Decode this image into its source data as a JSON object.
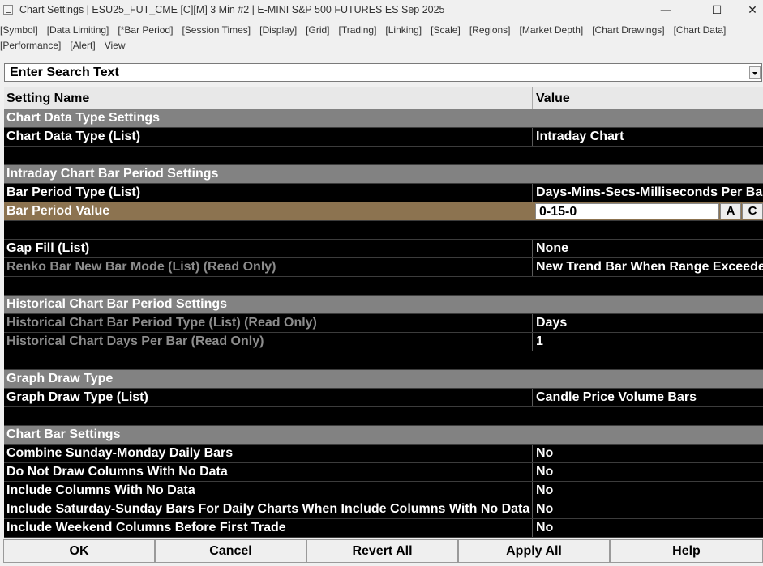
{
  "window": {
    "title": "Chart Settings | ESU25_FUT_CME [C][M]  3 Min  #2 | E-MINI S&P 500 FUTURES ES Sep 2025",
    "minimize": "—",
    "maximize": "☐",
    "close": "✕"
  },
  "menu": [
    "[Symbol]",
    "[Data Limiting]",
    "[*Bar Period]",
    "[Session Times]",
    "[Display]",
    "[Grid]",
    "[Trading]",
    "[Linking]",
    "[Scale]",
    "[Regions]",
    "[Market Depth]",
    "[Chart Drawings]",
    "[Chart Data]",
    "[Performance]",
    "[Alert]",
    "View"
  ],
  "search": {
    "text": "Enter Search Text"
  },
  "grid": {
    "header_name": "Setting Name",
    "header_value": "Value",
    "rows": [
      {
        "type": "section",
        "name": "Chart Data Type Settings"
      },
      {
        "type": "setting",
        "name": "Chart Data Type (List)",
        "value": "Intraday Chart"
      },
      {
        "type": "empty"
      },
      {
        "type": "section",
        "name": "Intraday Chart Bar Period Settings"
      },
      {
        "type": "setting",
        "name": "Bar Period Type (List)",
        "value": "Days-Mins-Secs-Milliseconds Per Bar"
      },
      {
        "type": "selected",
        "name": "Bar Period Value",
        "value": "0-15-0"
      },
      {
        "type": "empty"
      },
      {
        "type": "setting",
        "name": "Gap Fill (List)",
        "value": "None"
      },
      {
        "type": "readonly",
        "name": "Renko Bar New Bar Mode (List) (Read Only)",
        "value": "New Trend Bar When Range Exceeded"
      },
      {
        "type": "empty"
      },
      {
        "type": "section",
        "name": "Historical Chart Bar Period Settings"
      },
      {
        "type": "readonly",
        "name": "Historical Chart Bar Period Type (List) (Read Only)",
        "value": "Days"
      },
      {
        "type": "readonly",
        "name": "Historical Chart Days Per Bar (Read Only)",
        "value": "1"
      },
      {
        "type": "empty"
      },
      {
        "type": "section",
        "name": "Graph Draw Type"
      },
      {
        "type": "setting",
        "name": "Graph Draw Type (List)",
        "value": "Candle Price Volume Bars"
      },
      {
        "type": "empty"
      },
      {
        "type": "section",
        "name": "Chart Bar Settings"
      },
      {
        "type": "setting",
        "name": "Combine Sunday-Monday Daily Bars",
        "value": "No"
      },
      {
        "type": "setting",
        "name": "Do Not Draw Columns With No Data",
        "value": "No"
      },
      {
        "type": "setting",
        "name": "Include Columns With No Data",
        "value": "No"
      },
      {
        "type": "setting",
        "name": "Include Saturday-Sunday Bars For Daily Charts When Include Columns With No Data",
        "value": "No"
      },
      {
        "type": "setting",
        "name": "Include Weekend Columns Before First Trade",
        "value": "No"
      }
    ],
    "edit_buttons": [
      "A",
      "C"
    ]
  },
  "buttons": [
    "OK",
    "Cancel",
    "Revert All",
    "Apply All",
    "Help"
  ],
  "colors": {
    "section_bg": "#828282",
    "selected_bg": "#8c7350",
    "readonly_text": "#8c8c8c",
    "grid_bg": "#000000"
  }
}
